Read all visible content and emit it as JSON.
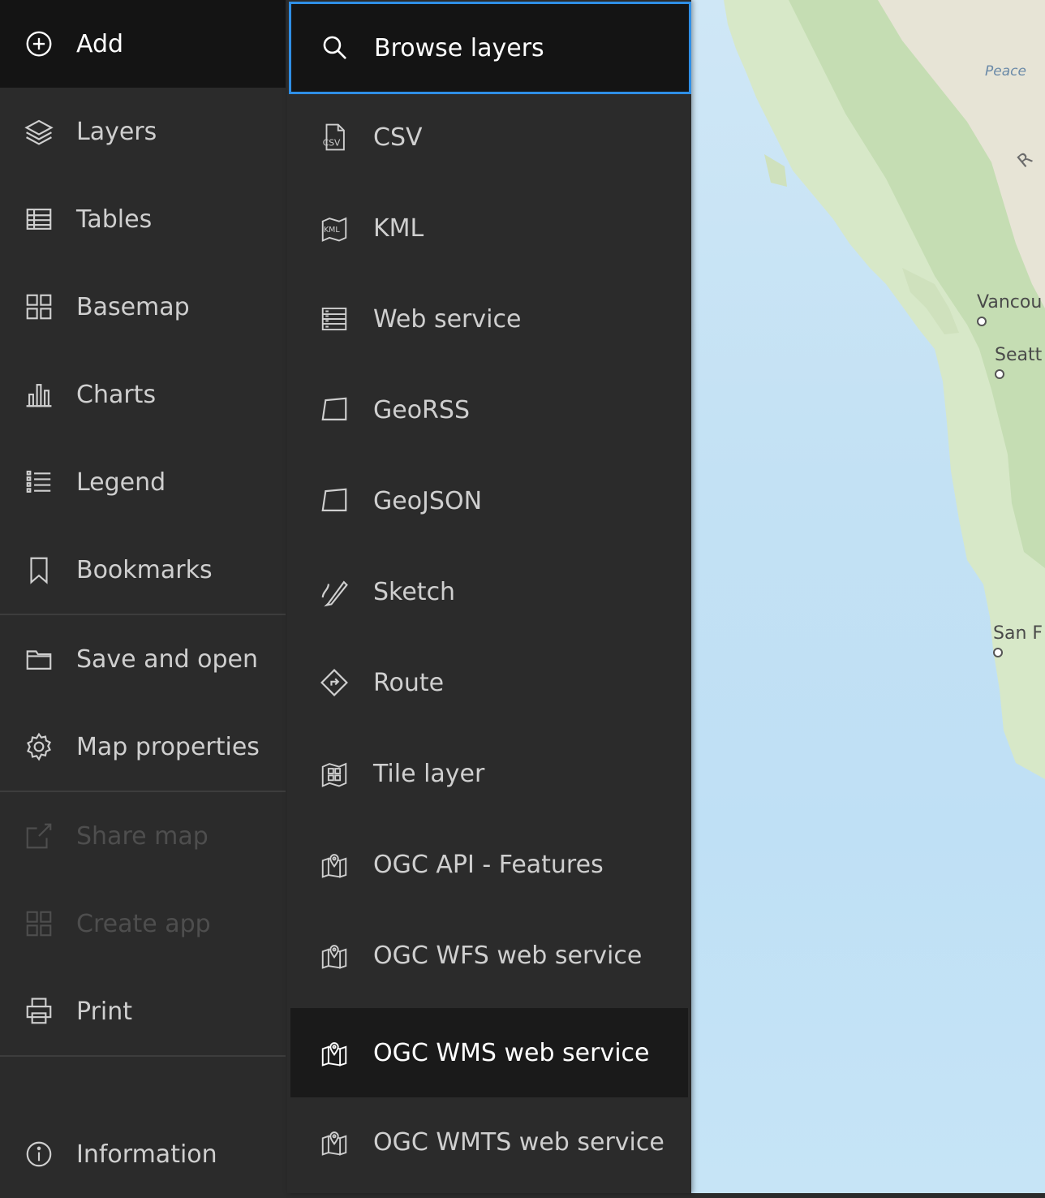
{
  "sidebar": {
    "items": [
      {
        "label": "Add",
        "icon": "plus-circle-icon"
      },
      {
        "label": "Layers",
        "icon": "layers-icon"
      },
      {
        "label": "Tables",
        "icon": "table-icon"
      },
      {
        "label": "Basemap",
        "icon": "basemap-icon"
      },
      {
        "label": "Charts",
        "icon": "chart-icon"
      },
      {
        "label": "Legend",
        "icon": "legend-icon"
      },
      {
        "label": "Bookmarks",
        "icon": "bookmark-icon"
      },
      {
        "label": "Save and open",
        "icon": "folder-icon"
      },
      {
        "label": "Map properties",
        "icon": "gear-icon"
      },
      {
        "label": "Share map",
        "icon": "share-icon"
      },
      {
        "label": "Create app",
        "icon": "apps-icon"
      },
      {
        "label": "Print",
        "icon": "printer-icon"
      },
      {
        "label": "Information",
        "icon": "info-icon"
      }
    ]
  },
  "add_menu": {
    "items": [
      {
        "label": "Browse layers",
        "icon": "search-icon"
      },
      {
        "label": "CSV",
        "icon": "csv-file-icon"
      },
      {
        "label": "KML",
        "icon": "kml-icon"
      },
      {
        "label": "Web service",
        "icon": "web-service-icon"
      },
      {
        "label": "GeoRSS",
        "icon": "map-sheet-icon"
      },
      {
        "label": "GeoJSON",
        "icon": "map-sheet-icon"
      },
      {
        "label": "Sketch",
        "icon": "sketch-icon"
      },
      {
        "label": "Route",
        "icon": "route-icon"
      },
      {
        "label": "Tile layer",
        "icon": "tile-layer-icon"
      },
      {
        "label": "OGC API - Features",
        "icon": "map-pin-icon"
      },
      {
        "label": "OGC WFS web service",
        "icon": "map-pin-icon"
      },
      {
        "label": "OGC WMS web service",
        "icon": "map-pin-icon"
      },
      {
        "label": "OGC WMTS web service",
        "icon": "map-pin-icon"
      }
    ]
  },
  "map": {
    "labels": {
      "peace": "Peace",
      "vancouver": "Vancou",
      "seattle": "Seatt",
      "sanfran": "San F",
      "r": "R"
    }
  },
  "colors": {
    "panel": "#2b2b2b",
    "active": "#141414",
    "focus_border": "#2f8fe6",
    "text": "#cfcfcf",
    "disabled": "#4e4e4e"
  }
}
